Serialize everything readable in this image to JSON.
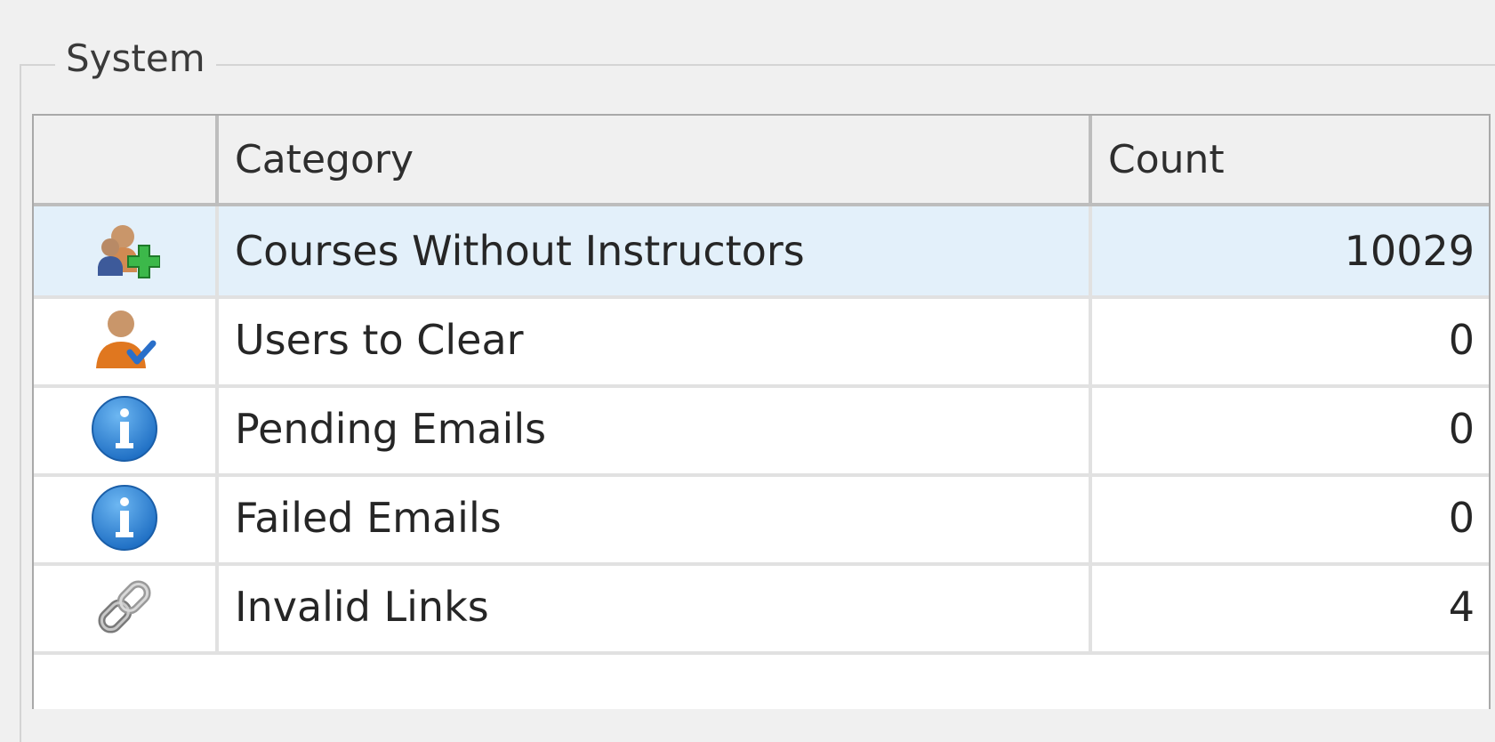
{
  "groupbox": {
    "title": "System"
  },
  "grid": {
    "columns": {
      "icon": "",
      "category": "Category",
      "count": "Count"
    },
    "rows": [
      {
        "icon": "user-add-icon",
        "category": "Courses Without Instructors",
        "count": "10029",
        "selected": true
      },
      {
        "icon": "user-check-icon",
        "category": "Users to Clear",
        "count": "0",
        "selected": false
      },
      {
        "icon": "info-icon",
        "category": "Pending Emails",
        "count": "0",
        "selected": false
      },
      {
        "icon": "info-icon",
        "category": "Failed Emails",
        "count": "0",
        "selected": false
      },
      {
        "icon": "chain-link-icon",
        "category": "Invalid Links",
        "count": "4",
        "selected": false
      }
    ]
  },
  "colors": {
    "selected_row": "#e3f0fa",
    "info_blue": "#2a7fd4",
    "add_green": "#3cb84a",
    "user_orange": "#e0771f"
  }
}
